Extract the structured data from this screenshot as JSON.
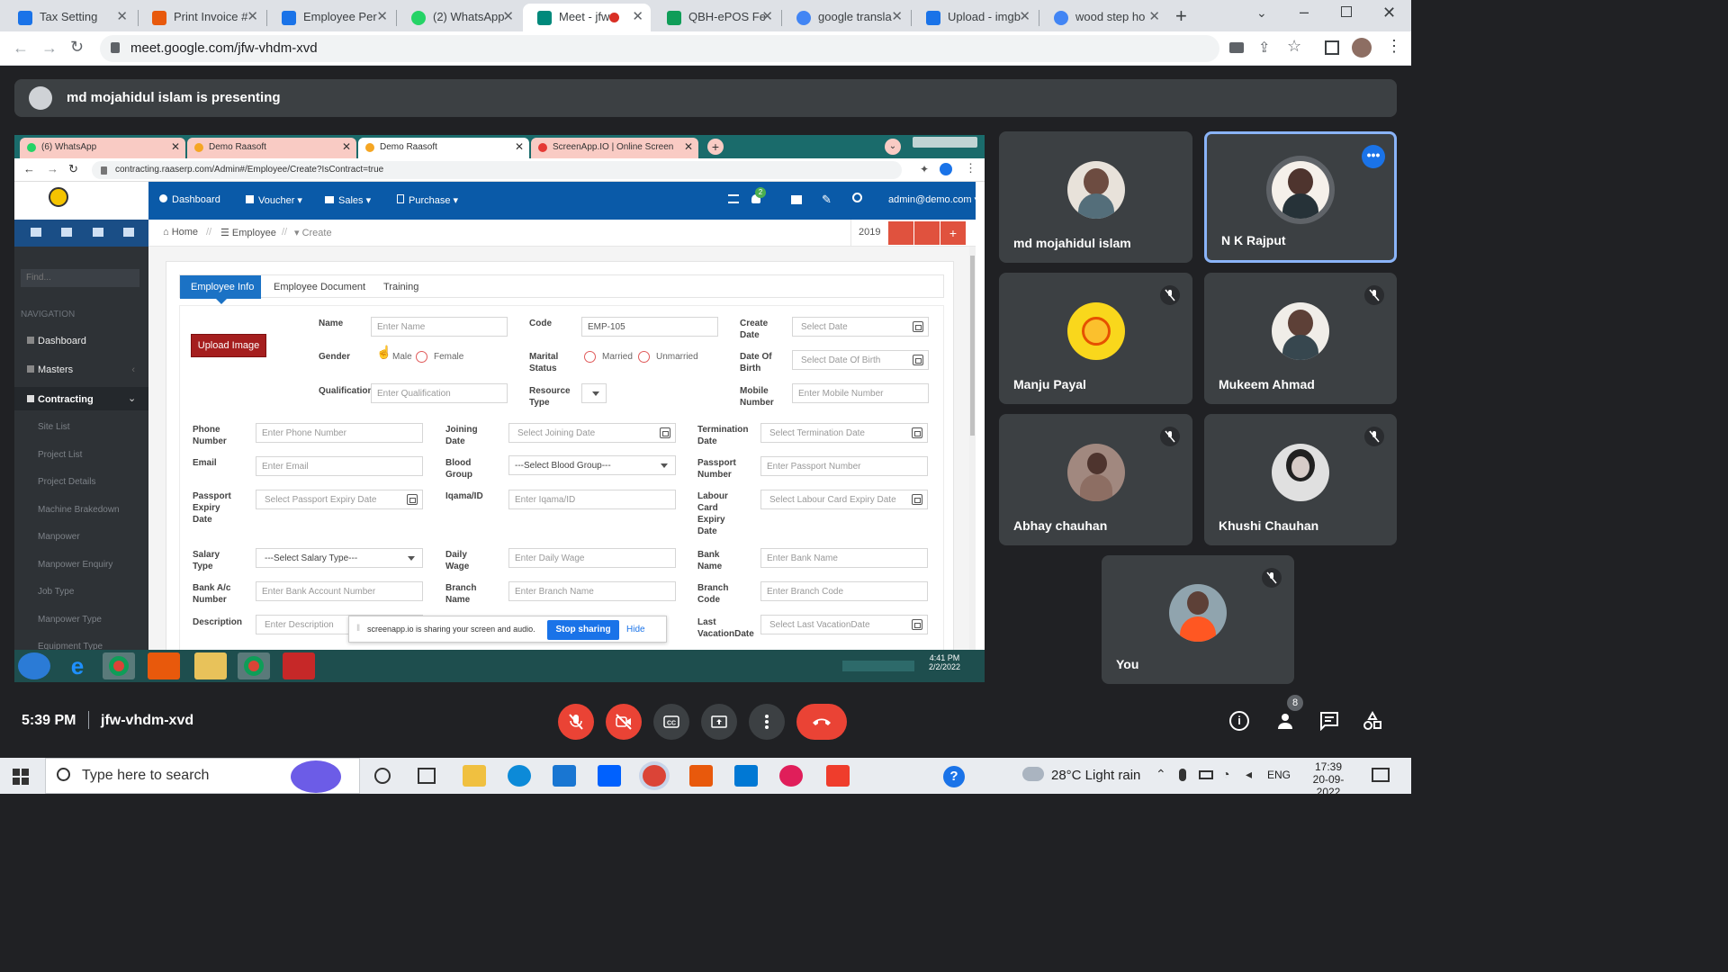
{
  "outer_tabs": [
    {
      "label": "Tax Setting",
      "color": "#1a73e8"
    },
    {
      "label": "Print Invoice #",
      "color": "#e8590c"
    },
    {
      "label": "Employee Per",
      "color": "#1a73e8"
    },
    {
      "label": "(2) WhatsApp",
      "color": "#25d366"
    },
    {
      "label": "Meet - jfw",
      "color": "#00897b"
    },
    {
      "label": "QBH-ePOS Fe",
      "color": "#0f9d58"
    },
    {
      "label": "google transla",
      "color": "#4285f4"
    },
    {
      "label": "Upload - imgb",
      "color": "#1a73e8"
    },
    {
      "label": "wood step ho",
      "color": "#4285f4"
    }
  ],
  "outer_url": "meet.google.com/jfw-vhdm-xvd",
  "banner_text": "md mojahidul islam is presenting",
  "inner_tabs": [
    {
      "label": "(6) WhatsApp",
      "color": "#25d366"
    },
    {
      "label": "Demo Raasoft",
      "color": "#f5a623"
    },
    {
      "label": "Demo Raasoft",
      "color": "#f5a623"
    },
    {
      "label": "ScreenApp.IO | Online Screen",
      "color": "#e53935"
    }
  ],
  "inner_url": "contracting.raaserp.com/Admin#/Employee/Create?IsContract=true",
  "topnav": {
    "dashboard": "Dashboard",
    "voucher": "Voucher",
    "sales": "Sales",
    "purchase": "Purchase",
    "notif_count": "2",
    "user": "admin@demo.com"
  },
  "sidebar": {
    "find_placeholder": "Find...",
    "nav_header": "NAVIGATION",
    "dashboard": "Dashboard",
    "masters": "Masters",
    "contracting": "Contracting",
    "sub_items": [
      "Site List",
      "Project List",
      "Project Details",
      "Machine Brakedown",
      "Manpower",
      "Manpower Enquiry",
      "Job Type",
      "Manpower Type",
      "Equipment Type"
    ]
  },
  "breadcrumb": {
    "home": "Home",
    "employee": "Employee",
    "create": "Create"
  },
  "year": "2019",
  "form_tabs": [
    "Employee Info",
    "Employee Document",
    "Training"
  ],
  "upload_label": "Upload Image",
  "fields": {
    "name": {
      "label": "Name",
      "placeholder": "Enter Name"
    },
    "code": {
      "label": "Code",
      "value": "EMP-105"
    },
    "create_date": {
      "label": "Create Date",
      "placeholder": "Select Date"
    },
    "gender": {
      "label": "Gender",
      "male": "Male",
      "female": "Female"
    },
    "marital": {
      "label": "Marital Status",
      "married": "Married",
      "unmarried": "Unmarried"
    },
    "dob": {
      "label": "Date Of Birth",
      "placeholder": "Select Date Of Birth"
    },
    "qualification": {
      "label": "Qualification",
      "placeholder": "Enter Qualification"
    },
    "resource_type": {
      "label": "Resource Type"
    },
    "mobile": {
      "label": "Mobile Number",
      "placeholder": "Enter Mobile Number"
    },
    "phone": {
      "label": "Phone Number",
      "placeholder": "Enter Phone Number"
    },
    "joining": {
      "label": "Joining Date",
      "placeholder": "Select Joining Date"
    },
    "termination": {
      "label": "Termination Date",
      "placeholder": "Select Termination Date"
    },
    "email": {
      "label": "Email",
      "placeholder": "Enter Email"
    },
    "blood": {
      "label": "Blood Group",
      "placeholder": "---Select Blood Group---"
    },
    "passport": {
      "label": "Passport Number",
      "placeholder": "Enter Passport Number"
    },
    "passport_expiry": {
      "label": "Passport Expiry Date",
      "placeholder": "Select Passport Expiry Date"
    },
    "iqama": {
      "label": "Iqama/ID",
      "placeholder": "Enter Iqama/ID"
    },
    "labour": {
      "label": "Labour Card Expiry Date",
      "placeholder": "Select Labour Card Expiry Date"
    },
    "salary": {
      "label": "Salary Type",
      "placeholder": "---Select Salary Type---"
    },
    "daily_wage": {
      "label": "Daily Wage",
      "placeholder": "Enter Daily Wage"
    },
    "bank_name": {
      "label": "Bank Name",
      "placeholder": "Enter Bank Name"
    },
    "bank_ac": {
      "label": "Bank A/c Number",
      "placeholder": "Enter Bank Account Number"
    },
    "branch_name": {
      "label": "Branch Name",
      "placeholder": "Enter Branch Name"
    },
    "branch_code": {
      "label": "Branch Code",
      "placeholder": "Enter Branch Code"
    },
    "description": {
      "label": "Description",
      "placeholder": "Enter Description"
    },
    "last_vacation": {
      "label": "Last VacationDate",
      "placeholder": "Select Last VacationDate"
    }
  },
  "share_bar": {
    "text": "screenapp.io is sharing your screen and audio.",
    "stop": "Stop sharing",
    "hide": "Hide"
  },
  "inner_clock": {
    "time": "4:41 PM",
    "date": "2/2/2022"
  },
  "participants": [
    {
      "name": "md mojahidul islam",
      "muted": false
    },
    {
      "name": "N K Rajput",
      "muted": false
    },
    {
      "name": "Manju Payal",
      "muted": true
    },
    {
      "name": "Mukeem Ahmad",
      "muted": true
    },
    {
      "name": "Abhay chauhan",
      "muted": true
    },
    {
      "name": "Khushi Chauhan",
      "muted": true
    },
    {
      "name": "You",
      "muted": true
    }
  ],
  "meeting": {
    "time": "5:39 PM",
    "code": "jfw-vhdm-xvd",
    "people_count": "8"
  },
  "win_taskbar": {
    "search_placeholder": "Type here to search",
    "weather": "28°C  Light rain",
    "lang": "ENG",
    "time": "17:39",
    "date": "20-09-2022"
  }
}
